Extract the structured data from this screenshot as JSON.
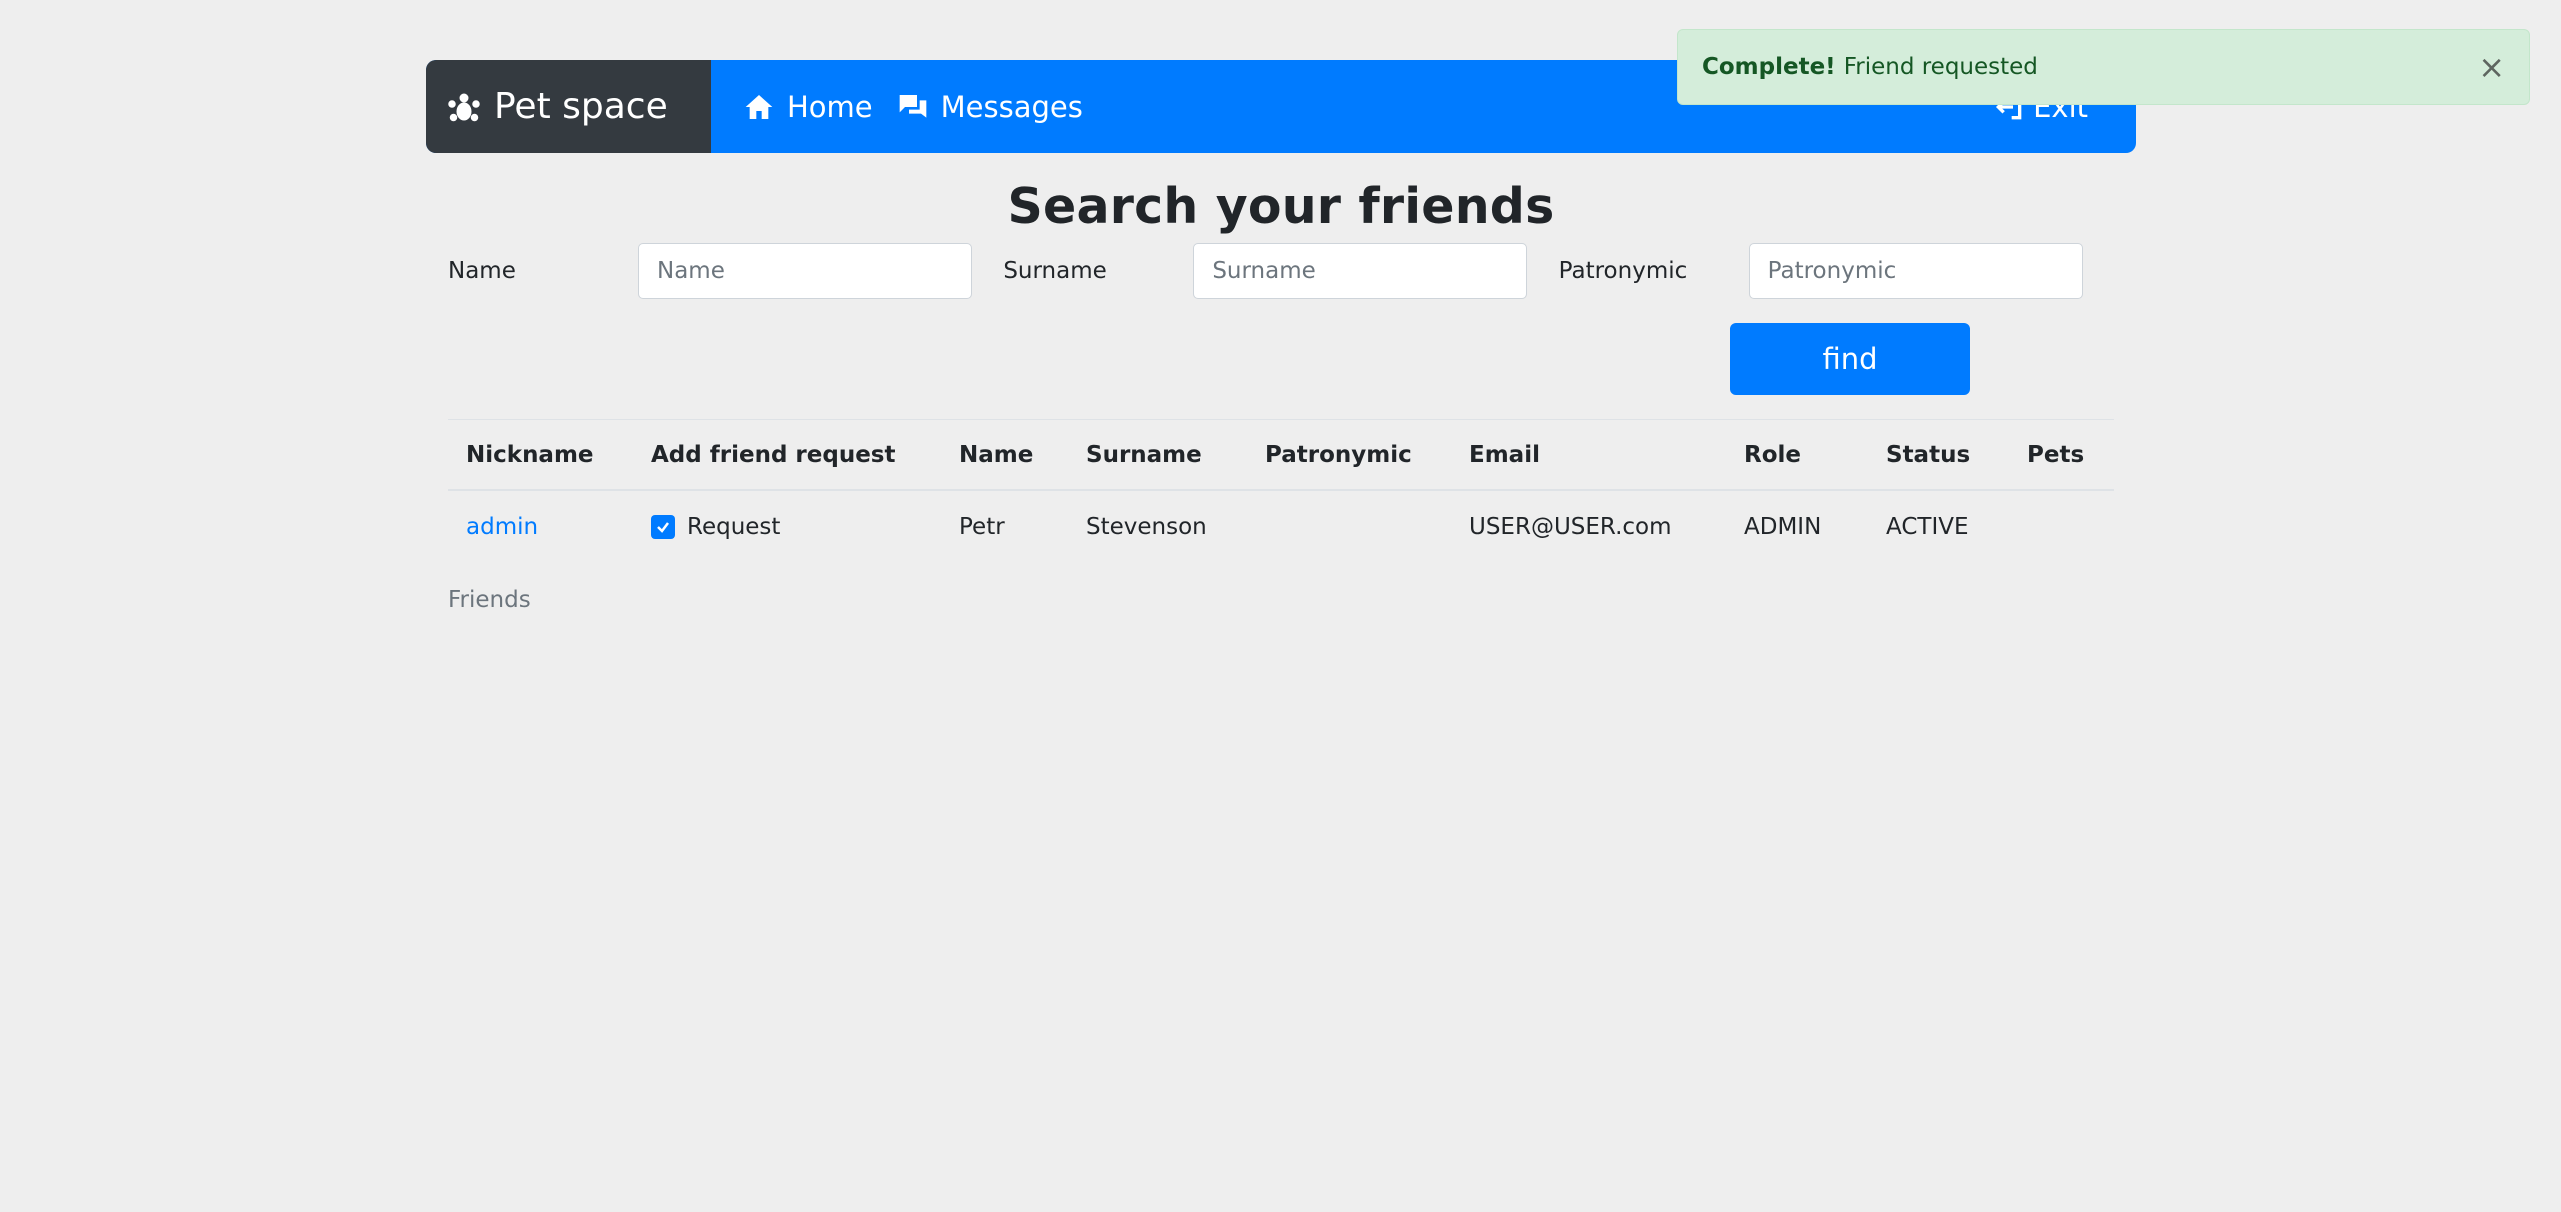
{
  "navbar": {
    "brand": "Pet space",
    "home_label": "Home",
    "messages_label": "Messages",
    "exit_label": "Exit"
  },
  "page": {
    "title": "Search your friends"
  },
  "form": {
    "name_label": "Name",
    "name_placeholder": "Name",
    "surname_label": "Surname",
    "surname_placeholder": "Surname",
    "patronymic_label": "Patronymic",
    "patronymic_placeholder": "Patronymic",
    "find_label": "find"
  },
  "table": {
    "headers": [
      "Nickname",
      "Add friend request",
      "Name",
      "Surname",
      "Patronymic",
      "Email",
      "Role",
      "Status",
      "Pets"
    ],
    "rows": [
      {
        "nickname": "admin",
        "request_label": "Request",
        "request_checked": true,
        "name": "Petr",
        "surname": "Stevenson",
        "patronymic": "",
        "email": "USER@USER.com",
        "role": "ADMIN",
        "status": "ACTIVE",
        "pets": ""
      }
    ]
  },
  "friends_label": "Friends",
  "toast": {
    "title": "Complete!",
    "message": "Friend requested",
    "close_symbol": "×"
  },
  "colors": {
    "primary": "#007bff",
    "brand_bg": "#343a40",
    "page_bg": "#eeeeee",
    "toast_bg": "#d4edda",
    "toast_text": "#155724"
  },
  "icons": {
    "brand": "paw-icon",
    "home": "home-icon",
    "messages": "chat-icon",
    "exit": "exit-icon",
    "check": "check-icon"
  }
}
